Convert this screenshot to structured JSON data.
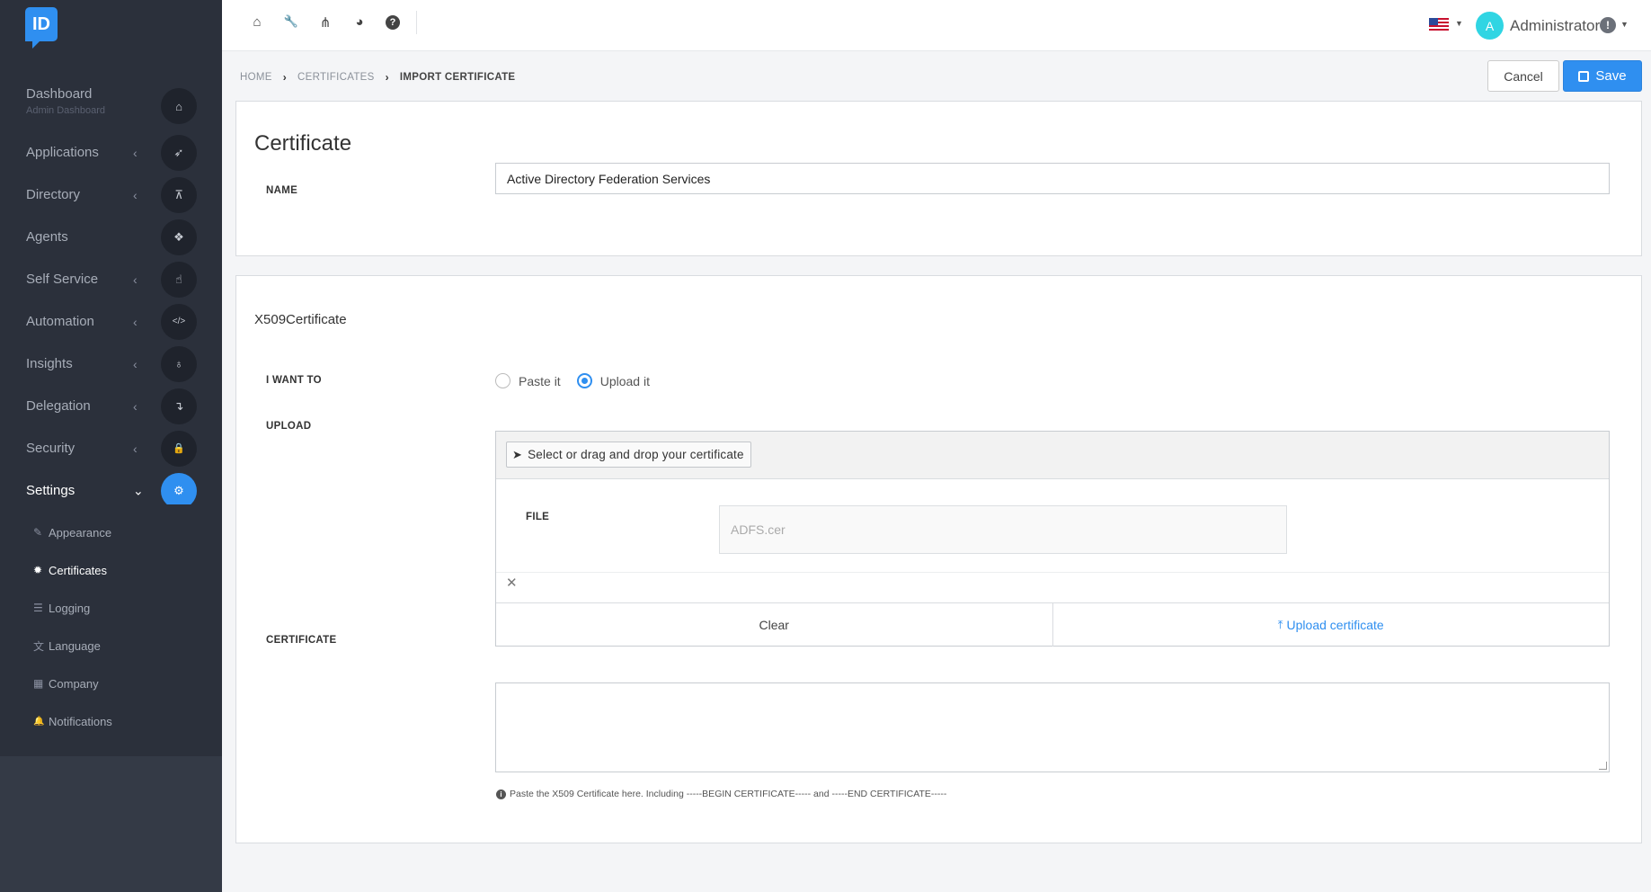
{
  "app": {
    "logo_text": "ID"
  },
  "sidebar": {
    "items": [
      {
        "label": "Dashboard",
        "sub": "Admin Dashboard",
        "icon": "home-icon",
        "glyph": "⌂"
      },
      {
        "label": "Applications",
        "icon": "rocket-icon",
        "glyph": "➶",
        "chevron": "‹"
      },
      {
        "label": "Directory",
        "icon": "sitemap-icon",
        "glyph": "⊼",
        "chevron": "‹"
      },
      {
        "label": "Agents",
        "icon": "cubes-icon",
        "glyph": "❖"
      },
      {
        "label": "Self Service",
        "icon": "hand-pointer-icon",
        "glyph": "☝",
        "chevron": "‹"
      },
      {
        "label": "Automation",
        "icon": "code-icon",
        "glyph": "</>",
        "chevron": "‹"
      },
      {
        "label": "Insights",
        "icon": "lightbulb-icon",
        "glyph": "♁",
        "chevron": "‹"
      },
      {
        "label": "Delegation",
        "icon": "level-down-icon",
        "glyph": "↴",
        "chevron": "‹"
      },
      {
        "label": "Security",
        "icon": "lock-icon",
        "glyph": "🔒",
        "chevron": "‹"
      },
      {
        "label": "Settings",
        "icon": "gear-icon",
        "glyph": "⚙",
        "chevron": "⌄"
      }
    ],
    "settings_items": [
      {
        "label": "Appearance",
        "icon": "paintbrush-icon",
        "glyph": "✎"
      },
      {
        "label": "Certificates",
        "icon": "certificate-icon",
        "glyph": "✹"
      },
      {
        "label": "Logging",
        "icon": "database-icon",
        "glyph": "☰"
      },
      {
        "label": "Language",
        "icon": "language-icon",
        "glyph": "文"
      },
      {
        "label": "Company",
        "icon": "building-icon",
        "glyph": "▦"
      },
      {
        "label": "Notifications",
        "icon": "bell-icon",
        "glyph": "🔔"
      }
    ]
  },
  "topbar": {
    "icons": [
      "home-icon",
      "wrench-icon",
      "share-icon",
      "pie-chart-icon",
      "help-icon"
    ],
    "glyphs": [
      "⌂",
      "🔧",
      "⋔",
      "◕",
      "?"
    ],
    "user_initial": "A",
    "user_name": "Administrator",
    "alert_glyph": "!"
  },
  "breadcrumb": {
    "home": "HOME",
    "certificates": "CERTIFICATES",
    "current": "IMPORT CERTIFICATE",
    "sep": "›"
  },
  "actions": {
    "cancel": "Cancel",
    "save": "Save"
  },
  "certificate_panel": {
    "title": "Certificate",
    "name_label": "NAME",
    "name_value": "Active Directory Federation Services"
  },
  "x509_panel": {
    "title": "X509Certificate",
    "i_want_to_label": "I WANT TO",
    "options": [
      "Paste it",
      "Upload it"
    ],
    "selected_option": "Upload it",
    "upload_label": "UPLOAD",
    "select_button": "Select or drag and drop your certificate",
    "file_label": "FILE",
    "file_value": "ADFS.cer",
    "clear_button": "Clear",
    "upload_button": "Upload certificate",
    "certificate_label": "CERTIFICATE",
    "certificate_value": "",
    "help_text": "Paste the X509 Certificate here. Including -----BEGIN CERTIFICATE----- and -----END CERTIFICATE-----"
  },
  "colors": {
    "accent": "#2f8ff0",
    "sidebar": "#2b303b",
    "avatar": "#30d5e3"
  }
}
